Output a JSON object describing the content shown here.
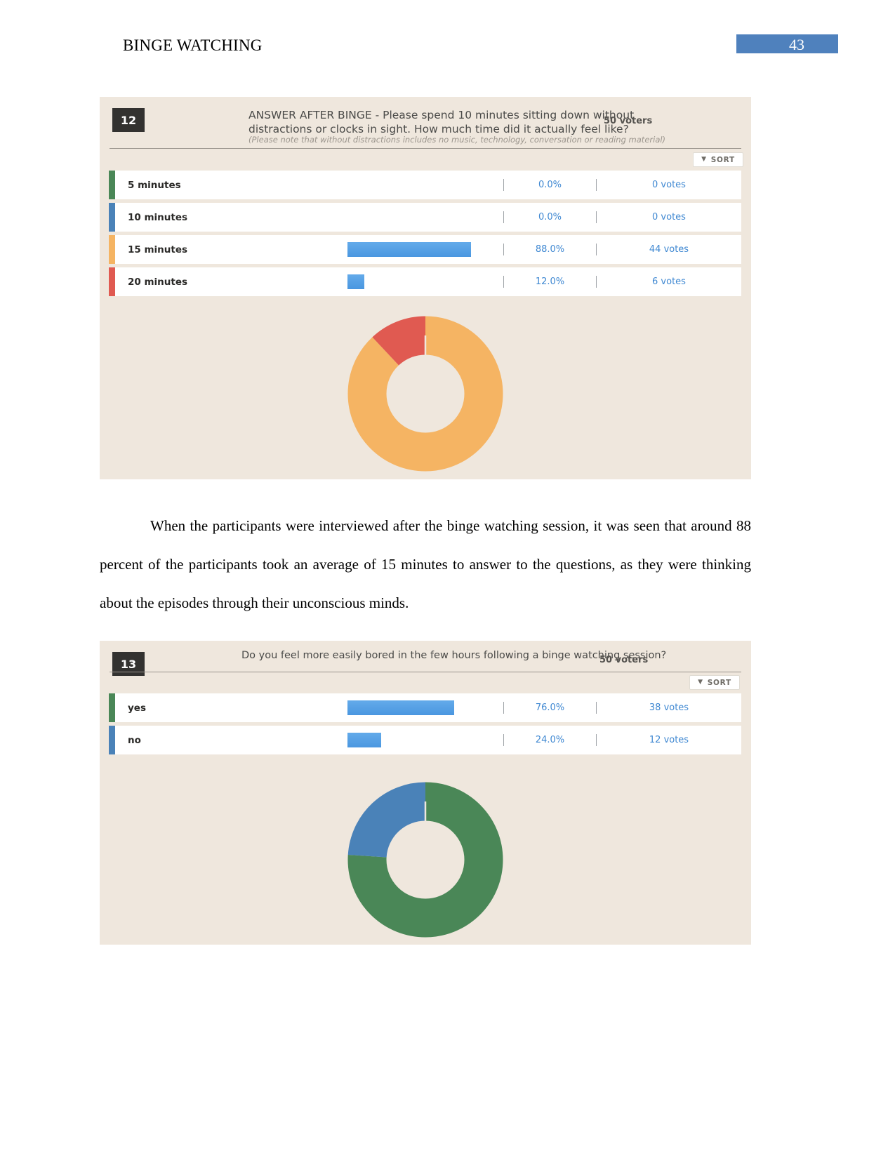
{
  "document": {
    "running_header": "BINGE WATCHING",
    "page_number": "43"
  },
  "polls": [
    {
      "number": "12",
      "question": "ANSWER AFTER BINGE - Please spend 10 minutes sitting down without distractions or clocks in sight. How much time did it actually feel like?",
      "note": "(Please note that without distractions includes no music, technology, conversation or reading material)",
      "voters": "50 voters",
      "sort_label": "SORT",
      "options": [
        {
          "label": "5 minutes",
          "percent": "0.0%",
          "votes": "0 votes",
          "chip": "#4a8757",
          "value": 0
        },
        {
          "label": "10 minutes",
          "percent": "0.0%",
          "votes": "0 votes",
          "chip": "#4a82b8",
          "value": 0
        },
        {
          "label": "15 minutes",
          "percent": "88.0%",
          "votes": "44 votes",
          "chip": "#f5b463",
          "value": 88
        },
        {
          "label": "20 minutes",
          "percent": "12.0%",
          "votes": "6 votes",
          "chip": "#e05a51",
          "value": 12
        }
      ]
    },
    {
      "number": "13",
      "question": "Do you feel more easily bored in the few hours following a binge watching session?",
      "note": "",
      "voters": "50 voters",
      "sort_label": "SORT",
      "options": [
        {
          "label": "yes",
          "percent": "76.0%",
          "votes": "38 votes",
          "chip": "#4a8757",
          "value": 76
        },
        {
          "label": "no",
          "percent": "24.0%",
          "votes": "12 votes",
          "chip": "#4a82b8",
          "value": 24
        }
      ]
    }
  ],
  "paragraph": "When the participants were interviewed after the binge watching session, it was seen that around 88 percent of the participants took an average of 15 minutes to answer to the questions, as they were thinking about the episodes through their unconscious minds.",
  "chart_data": [
    {
      "type": "pie",
      "title": "ANSWER AFTER BINGE - Please spend 10 minutes sitting down without distractions or clocks in sight. How much time did it actually feel like?",
      "categories": [
        "5 minutes",
        "10 minutes",
        "15 minutes",
        "20 minutes"
      ],
      "values": [
        0,
        0,
        88,
        12
      ],
      "value_unit": "percent",
      "counts": [
        0,
        0,
        44,
        6
      ],
      "total_voters": 50,
      "colors": [
        "#4a8757",
        "#4a82b8",
        "#f5b463",
        "#e05a51"
      ],
      "donut": true,
      "legend": "none"
    },
    {
      "type": "pie",
      "title": "Do you feel more easily bored in the few hours following a binge watching session?",
      "categories": [
        "yes",
        "no"
      ],
      "values": [
        76,
        24
      ],
      "value_unit": "percent",
      "counts": [
        38,
        12
      ],
      "total_voters": 50,
      "colors": [
        "#4a8757",
        "#4a82b8"
      ],
      "donut": true,
      "legend": "none"
    }
  ]
}
